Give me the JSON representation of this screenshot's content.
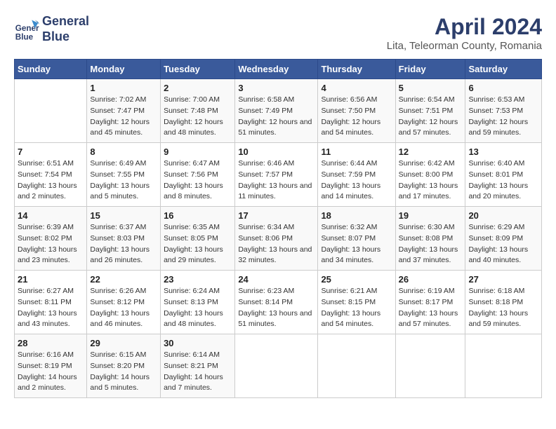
{
  "header": {
    "logo_line1": "General",
    "logo_line2": "Blue",
    "title": "April 2024",
    "subtitle": "Lita, Teleorman County, Romania"
  },
  "weekdays": [
    "Sunday",
    "Monday",
    "Tuesday",
    "Wednesday",
    "Thursday",
    "Friday",
    "Saturday"
  ],
  "weeks": [
    [
      {
        "day": "",
        "sunrise": "",
        "sunset": "",
        "daylight": ""
      },
      {
        "day": "1",
        "sunrise": "Sunrise: 7:02 AM",
        "sunset": "Sunset: 7:47 PM",
        "daylight": "Daylight: 12 hours and 45 minutes."
      },
      {
        "day": "2",
        "sunrise": "Sunrise: 7:00 AM",
        "sunset": "Sunset: 7:48 PM",
        "daylight": "Daylight: 12 hours and 48 minutes."
      },
      {
        "day": "3",
        "sunrise": "Sunrise: 6:58 AM",
        "sunset": "Sunset: 7:49 PM",
        "daylight": "Daylight: 12 hours and 51 minutes."
      },
      {
        "day": "4",
        "sunrise": "Sunrise: 6:56 AM",
        "sunset": "Sunset: 7:50 PM",
        "daylight": "Daylight: 12 hours and 54 minutes."
      },
      {
        "day": "5",
        "sunrise": "Sunrise: 6:54 AM",
        "sunset": "Sunset: 7:51 PM",
        "daylight": "Daylight: 12 hours and 57 minutes."
      },
      {
        "day": "6",
        "sunrise": "Sunrise: 6:53 AM",
        "sunset": "Sunset: 7:53 PM",
        "daylight": "Daylight: 12 hours and 59 minutes."
      }
    ],
    [
      {
        "day": "7",
        "sunrise": "Sunrise: 6:51 AM",
        "sunset": "Sunset: 7:54 PM",
        "daylight": "Daylight: 13 hours and 2 minutes."
      },
      {
        "day": "8",
        "sunrise": "Sunrise: 6:49 AM",
        "sunset": "Sunset: 7:55 PM",
        "daylight": "Daylight: 13 hours and 5 minutes."
      },
      {
        "day": "9",
        "sunrise": "Sunrise: 6:47 AM",
        "sunset": "Sunset: 7:56 PM",
        "daylight": "Daylight: 13 hours and 8 minutes."
      },
      {
        "day": "10",
        "sunrise": "Sunrise: 6:46 AM",
        "sunset": "Sunset: 7:57 PM",
        "daylight": "Daylight: 13 hours and 11 minutes."
      },
      {
        "day": "11",
        "sunrise": "Sunrise: 6:44 AM",
        "sunset": "Sunset: 7:59 PM",
        "daylight": "Daylight: 13 hours and 14 minutes."
      },
      {
        "day": "12",
        "sunrise": "Sunrise: 6:42 AM",
        "sunset": "Sunset: 8:00 PM",
        "daylight": "Daylight: 13 hours and 17 minutes."
      },
      {
        "day": "13",
        "sunrise": "Sunrise: 6:40 AM",
        "sunset": "Sunset: 8:01 PM",
        "daylight": "Daylight: 13 hours and 20 minutes."
      }
    ],
    [
      {
        "day": "14",
        "sunrise": "Sunrise: 6:39 AM",
        "sunset": "Sunset: 8:02 PM",
        "daylight": "Daylight: 13 hours and 23 minutes."
      },
      {
        "day": "15",
        "sunrise": "Sunrise: 6:37 AM",
        "sunset": "Sunset: 8:03 PM",
        "daylight": "Daylight: 13 hours and 26 minutes."
      },
      {
        "day": "16",
        "sunrise": "Sunrise: 6:35 AM",
        "sunset": "Sunset: 8:05 PM",
        "daylight": "Daylight: 13 hours and 29 minutes."
      },
      {
        "day": "17",
        "sunrise": "Sunrise: 6:34 AM",
        "sunset": "Sunset: 8:06 PM",
        "daylight": "Daylight: 13 hours and 32 minutes."
      },
      {
        "day": "18",
        "sunrise": "Sunrise: 6:32 AM",
        "sunset": "Sunset: 8:07 PM",
        "daylight": "Daylight: 13 hours and 34 minutes."
      },
      {
        "day": "19",
        "sunrise": "Sunrise: 6:30 AM",
        "sunset": "Sunset: 8:08 PM",
        "daylight": "Daylight: 13 hours and 37 minutes."
      },
      {
        "day": "20",
        "sunrise": "Sunrise: 6:29 AM",
        "sunset": "Sunset: 8:09 PM",
        "daylight": "Daylight: 13 hours and 40 minutes."
      }
    ],
    [
      {
        "day": "21",
        "sunrise": "Sunrise: 6:27 AM",
        "sunset": "Sunset: 8:11 PM",
        "daylight": "Daylight: 13 hours and 43 minutes."
      },
      {
        "day": "22",
        "sunrise": "Sunrise: 6:26 AM",
        "sunset": "Sunset: 8:12 PM",
        "daylight": "Daylight: 13 hours and 46 minutes."
      },
      {
        "day": "23",
        "sunrise": "Sunrise: 6:24 AM",
        "sunset": "Sunset: 8:13 PM",
        "daylight": "Daylight: 13 hours and 48 minutes."
      },
      {
        "day": "24",
        "sunrise": "Sunrise: 6:23 AM",
        "sunset": "Sunset: 8:14 PM",
        "daylight": "Daylight: 13 hours and 51 minutes."
      },
      {
        "day": "25",
        "sunrise": "Sunrise: 6:21 AM",
        "sunset": "Sunset: 8:15 PM",
        "daylight": "Daylight: 13 hours and 54 minutes."
      },
      {
        "day": "26",
        "sunrise": "Sunrise: 6:19 AM",
        "sunset": "Sunset: 8:17 PM",
        "daylight": "Daylight: 13 hours and 57 minutes."
      },
      {
        "day": "27",
        "sunrise": "Sunrise: 6:18 AM",
        "sunset": "Sunset: 8:18 PM",
        "daylight": "Daylight: 13 hours and 59 minutes."
      }
    ],
    [
      {
        "day": "28",
        "sunrise": "Sunrise: 6:16 AM",
        "sunset": "Sunset: 8:19 PM",
        "daylight": "Daylight: 14 hours and 2 minutes."
      },
      {
        "day": "29",
        "sunrise": "Sunrise: 6:15 AM",
        "sunset": "Sunset: 8:20 PM",
        "daylight": "Daylight: 14 hours and 5 minutes."
      },
      {
        "day": "30",
        "sunrise": "Sunrise: 6:14 AM",
        "sunset": "Sunset: 8:21 PM",
        "daylight": "Daylight: 14 hours and 7 minutes."
      },
      {
        "day": "",
        "sunrise": "",
        "sunset": "",
        "daylight": ""
      },
      {
        "day": "",
        "sunrise": "",
        "sunset": "",
        "daylight": ""
      },
      {
        "day": "",
        "sunrise": "",
        "sunset": "",
        "daylight": ""
      },
      {
        "day": "",
        "sunrise": "",
        "sunset": "",
        "daylight": ""
      }
    ]
  ]
}
